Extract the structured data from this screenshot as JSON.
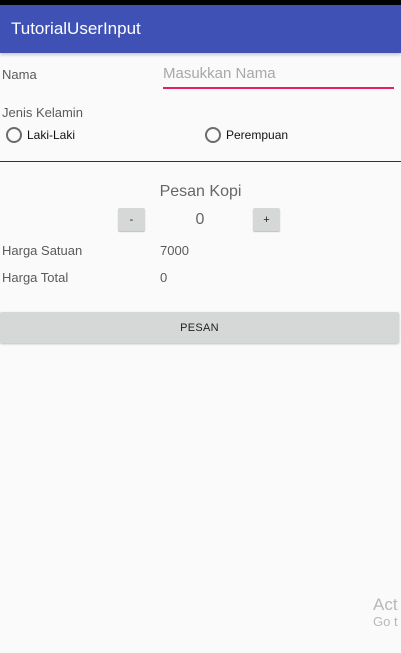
{
  "appbar": {
    "title": "TutorialUserInput"
  },
  "form": {
    "name_label": "Nama",
    "name_placeholder": "Masukkan Nama",
    "gender_label": "Jenis Kelamin",
    "gender_options": [
      "Laki-Laki",
      "Perempuan"
    ]
  },
  "order": {
    "section_title": "Pesan Kopi",
    "minus_label": "-",
    "plus_label": "+",
    "quantity": "0",
    "unit_price_label": "Harga Satuan",
    "unit_price_value": "7000",
    "total_label": "Harga Total",
    "total_value": "0",
    "submit_label": "PESAN"
  },
  "watermark": {
    "line1": "Act",
    "line2": "Go t"
  },
  "colors": {
    "appbar": "#3f51b5",
    "accent": "#e91e63",
    "button": "#d6d7d7"
  }
}
